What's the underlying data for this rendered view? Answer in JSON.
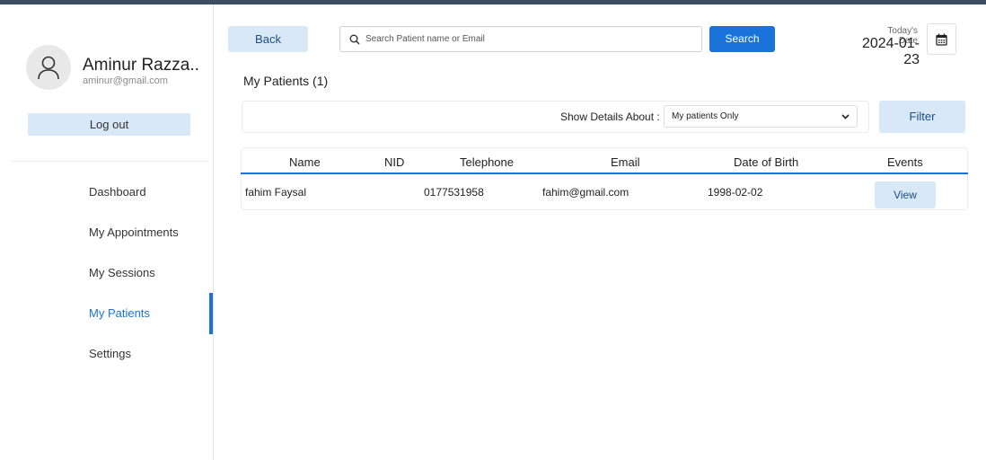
{
  "user": {
    "name": "Aminur Razza..",
    "email": "aminur@gmail.com",
    "logout_label": "Log out"
  },
  "nav": {
    "items": [
      {
        "label": "Dashboard"
      },
      {
        "label": "My Appointments"
      },
      {
        "label": "My Sessions"
      },
      {
        "label": "My Patients",
        "active": true
      },
      {
        "label": "Settings"
      }
    ]
  },
  "toolbar": {
    "back_label": "Back",
    "search_placeholder": "Search Patient name or Email",
    "search_label": "Search",
    "date_label": "Today's Date",
    "date_value": "2024-01-23"
  },
  "page": {
    "title": "My Patients (1)"
  },
  "filter": {
    "label": "Show Details About :",
    "selected": "My patients Only",
    "button_label": "Filter"
  },
  "table": {
    "headers": {
      "name": "Name",
      "nid": "NID",
      "telephone": "Telephone",
      "email": "Email",
      "dob": "Date of Birth",
      "events": "Events"
    },
    "rows": [
      {
        "name": "fahim Faysal",
        "nid": "",
        "telephone": "0177531958",
        "email": "fahim@gmail.com",
        "dob": "1998-02-02",
        "action_label": "View"
      }
    ]
  },
  "colors": {
    "accent": "#1a73d9",
    "light_button": "#d8e8f6",
    "topbar": "#3a4d61"
  }
}
